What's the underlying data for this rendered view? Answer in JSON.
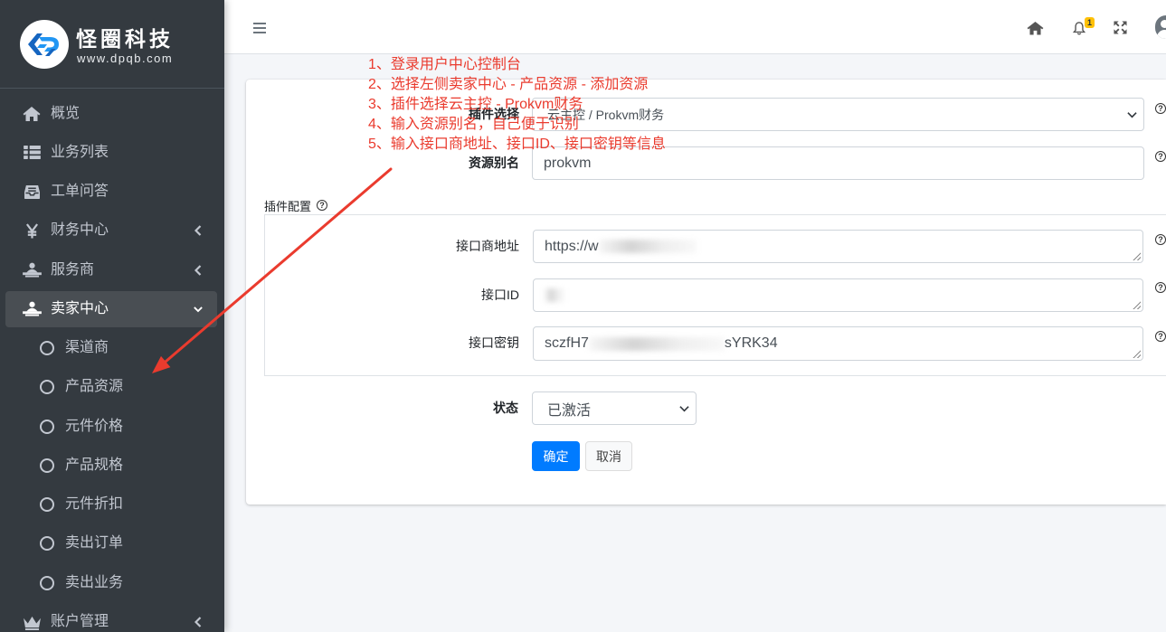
{
  "brand": {
    "name": "怪圈科技",
    "url": "www.dpqb.com",
    "logo_icon": "dpqb-logo-icon"
  },
  "sidebar": {
    "bg": "#343a40",
    "active_bg": "#494e53",
    "items": [
      {
        "label": "概览",
        "icon": "home-icon"
      },
      {
        "label": "业务列表",
        "icon": "list-icon"
      },
      {
        "label": "工单问答",
        "icon": "ticket-icon"
      },
      {
        "label": "财务中心",
        "icon": "yen-icon",
        "expand_icon": "chevron-left-icon"
      },
      {
        "label": "服务商",
        "icon": "provider-icon",
        "expand_icon": "chevron-left-icon"
      },
      {
        "label": "卖家中心",
        "icon": "seller-icon",
        "expand_icon": "chevron-down-icon",
        "active": true,
        "expanded": true
      }
    ],
    "seller_subitems": [
      {
        "label": "渠道商",
        "icon": "circle-icon"
      },
      {
        "label": "产品资源",
        "icon": "circle-icon"
      },
      {
        "label": "元件价格",
        "icon": "circle-icon"
      },
      {
        "label": "产品规格",
        "icon": "circle-icon"
      },
      {
        "label": "元件折扣",
        "icon": "circle-icon"
      },
      {
        "label": "卖出订单",
        "icon": "circle-icon"
      },
      {
        "label": "卖出业务",
        "icon": "circle-icon"
      }
    ],
    "more_items": [
      {
        "label": "账户管理",
        "icon": "crown-icon",
        "expand_icon": "chevron-left-icon"
      }
    ]
  },
  "header": {
    "menu_icon": "hamburger-icon",
    "right_icons": [
      "home-icon",
      "bell-icon",
      "fullscreen-icon",
      "user-avatar-icon"
    ],
    "notification_count": "1",
    "badge_color": "#ffc107"
  },
  "form": {
    "primary_color": "#007bff",
    "plugin_select": {
      "label": "插件选择",
      "value": "云主控 / Prokvm财务",
      "help_icon": "question-circle-icon"
    },
    "resource_alias": {
      "label": "资源别名",
      "value": "prokvm",
      "help_icon": "question-circle-icon"
    },
    "plugin_config": {
      "label": "插件配置",
      "help_icon": "question-circle-icon",
      "fields": [
        {
          "label": "接口商地址",
          "value_visible_start": "https://w",
          "value_masked": true
        },
        {
          "label": "接口ID",
          "value_masked": true
        },
        {
          "label": "接口密钥",
          "value_visible_start": "sczfH7",
          "value_visible_end": "sYRK34",
          "value_masked": true
        }
      ]
    },
    "status_select": {
      "label": "状态",
      "value": "已激活"
    },
    "buttons": {
      "confirm": "确定",
      "cancel": "取消"
    }
  },
  "annotation": {
    "color": "#ea3b2e",
    "steps": [
      "1、登录用户中心控制台",
      "2、选择左侧卖家中心 - 产品资源 - 添加资源",
      "3、插件选择云主控 - Prokvm财务",
      "4、输入资源别名，自己便于识别",
      "5、输入接口商地址、接口ID、接口密钥等信息"
    ]
  }
}
